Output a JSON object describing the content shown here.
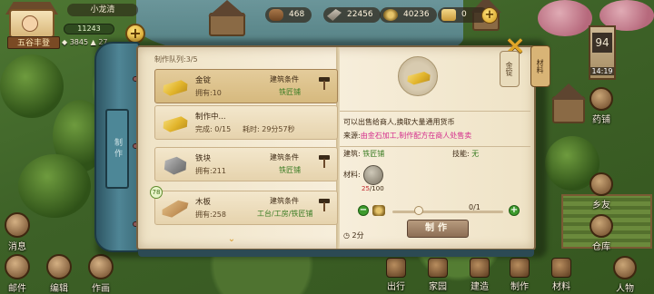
{
  "player": {
    "name": "小龙清",
    "title": "五谷丰登",
    "exp": "11243",
    "stat_a": "3845",
    "stat_b": "27"
  },
  "resources": [
    {
      "icon": "wood-icon",
      "value": "468"
    },
    {
      "icon": "hammer-tool-icon",
      "value": "22456"
    },
    {
      "icon": "coin-icon",
      "value": "40236"
    },
    {
      "icon": "scroll-icon",
      "value": "0"
    }
  ],
  "day_sign": {
    "day": "94",
    "time": "14:19"
  },
  "side_buttons": [
    {
      "label": "药铺",
      "icon": "apothecary-icon"
    },
    {
      "label": "乡友",
      "icon": "villager-icon"
    },
    {
      "label": "仓库",
      "icon": "warehouse-icon"
    },
    {
      "label": "人物",
      "icon": "character-icon"
    }
  ],
  "left_buttons": [
    {
      "label": "消息",
      "icon": "message-icon"
    },
    {
      "label": "邮件",
      "icon": "mail-icon"
    },
    {
      "label": "编辑",
      "icon": "edit-icon"
    },
    {
      "label": "作画",
      "icon": "paint-icon"
    }
  ],
  "bottom_bar": [
    {
      "label": "出行",
      "icon": "travel-icon"
    },
    {
      "label": "家园",
      "icon": "home-icon"
    },
    {
      "label": "建造",
      "icon": "build-icon"
    },
    {
      "label": "制作",
      "icon": "craft-icon"
    },
    {
      "label": "材料",
      "icon": "materials-icon"
    }
  ],
  "dialog": {
    "spine_label": "制作",
    "queue_label": "制作队列:3/5",
    "close_label": "×",
    "tab_current": "金锭",
    "tab_category": "材料",
    "items": [
      {
        "name": "金锭",
        "owned_label": "拥有:10",
        "cond_label": "建筑条件",
        "cond_value": "铁匠铺",
        "thumb": "gold-ingot",
        "selected": true
      },
      {
        "name": "制作中...",
        "owned_label": "完成: 0/15",
        "extra": "耗时: 29分57秒",
        "cond_label": "",
        "cond_value": "",
        "thumb": "gold-ingot",
        "selected": false
      },
      {
        "name": "铁块",
        "owned_label": "拥有:211",
        "cond_label": "建筑条件",
        "cond_value": "铁匠铺",
        "thumb": "iron-block",
        "selected": false
      },
      {
        "name": "木板",
        "owned_label": "拥有:258",
        "cond_label": "建筑条件",
        "cond_value": "工台/工房/铁匠铺",
        "thumb": "wood-plank",
        "selected": false,
        "badge": "78"
      }
    ],
    "detail": {
      "desc_line1": "可以出售给商人,换取大量通用货币",
      "desc_source_prefix": "来源:",
      "desc_source_link": "由金石加工,制作配方在商人处售卖",
      "building_label": "建筑:",
      "building_value": "铁匠铺",
      "skill_label": "技能:",
      "skill_value": "无",
      "material_label": "材料:",
      "material_have": "25",
      "material_need": "/100",
      "qty_text": "0/1",
      "time_label": "2分",
      "craft_label": "制作"
    }
  },
  "colors": {
    "book_paper": "#f7eedb",
    "accent_green": "#3c7d25",
    "link_pink": "#d42d8c",
    "warning_red": "#c1272d",
    "spine_teal": "#4f8595"
  }
}
